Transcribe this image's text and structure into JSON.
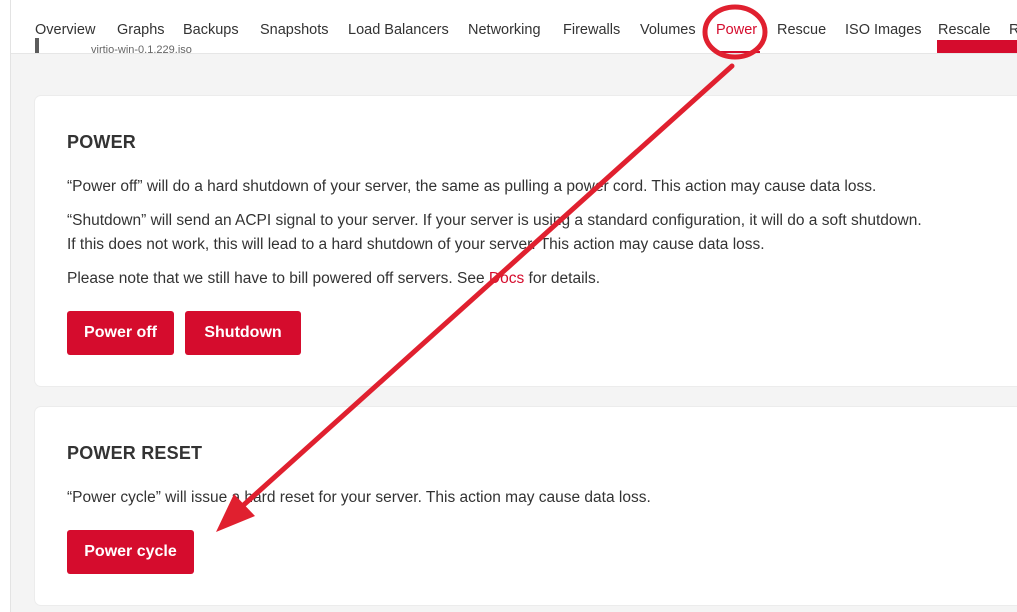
{
  "tabs": [
    {
      "label": "Overview"
    },
    {
      "label": "Graphs"
    },
    {
      "label": "Backups"
    },
    {
      "label": "Snapshots"
    },
    {
      "label": "Load Balancers"
    },
    {
      "label": "Networking"
    },
    {
      "label": "Firewalls"
    },
    {
      "label": "Volumes"
    },
    {
      "label": "Power",
      "active": true
    },
    {
      "label": "Rescue"
    },
    {
      "label": "ISO Images"
    },
    {
      "label": "Rescale"
    },
    {
      "label": "R"
    }
  ],
  "remnant": {
    "iso_text": "virtio-win-0.1.229.iso"
  },
  "power_section": {
    "title": "POWER",
    "p1": "“Power off” will do a hard shutdown of your server, the same as pulling a power cord. This action may cause data loss.",
    "p2_line1": "“Shutdown” will send an ACPI signal to your server. If your server is using a standard configuration, it will do a soft shutdown.",
    "p2_line2": "If this does not work, this will lead to a hard shutdown of your server. This action may cause data loss.",
    "p3_before": "Please note that we still have to bill powered off servers. See ",
    "p3_link": "Docs",
    "p3_after": " for details.",
    "power_off_label": "Power off",
    "shutdown_label": "Shutdown"
  },
  "reset_section": {
    "title": "POWER RESET",
    "p1": "“Power cycle” will issue a hard reset for your server. This action may cause data loss.",
    "power_cycle_label": "Power cycle"
  },
  "colors": {
    "accent": "#d50c2d",
    "annotation": "#e0202f"
  },
  "annotation": {
    "shape": "circle-and-arrow",
    "target_tab": "Power",
    "points_to": "Power cycle"
  }
}
